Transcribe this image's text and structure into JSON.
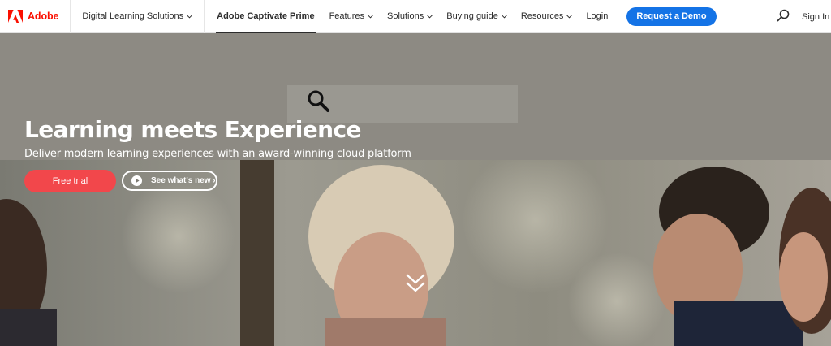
{
  "brand": {
    "name": "Adobe",
    "logo_icon": "adobe-logo",
    "color": "#fa0f00"
  },
  "nav": {
    "section": "Digital Learning Solutions",
    "product": "Adobe Captivate Prime",
    "menu": [
      "Features",
      "Solutions",
      "Buying guide",
      "Resources"
    ],
    "login": "Login",
    "cta": "Request a Demo",
    "search_icon": "search-icon",
    "signin": "Sign In",
    "accent": "#1473e6"
  },
  "hero": {
    "title": "Learning meets Experience",
    "subtitle": "Deliver modern learning experiences with an award-winning cloud platform",
    "primary_button": "Free trial",
    "secondary_button": "See what's new ›",
    "primary_color": "#f2474b",
    "scroll_icon": "double-chevron-down-icon"
  }
}
